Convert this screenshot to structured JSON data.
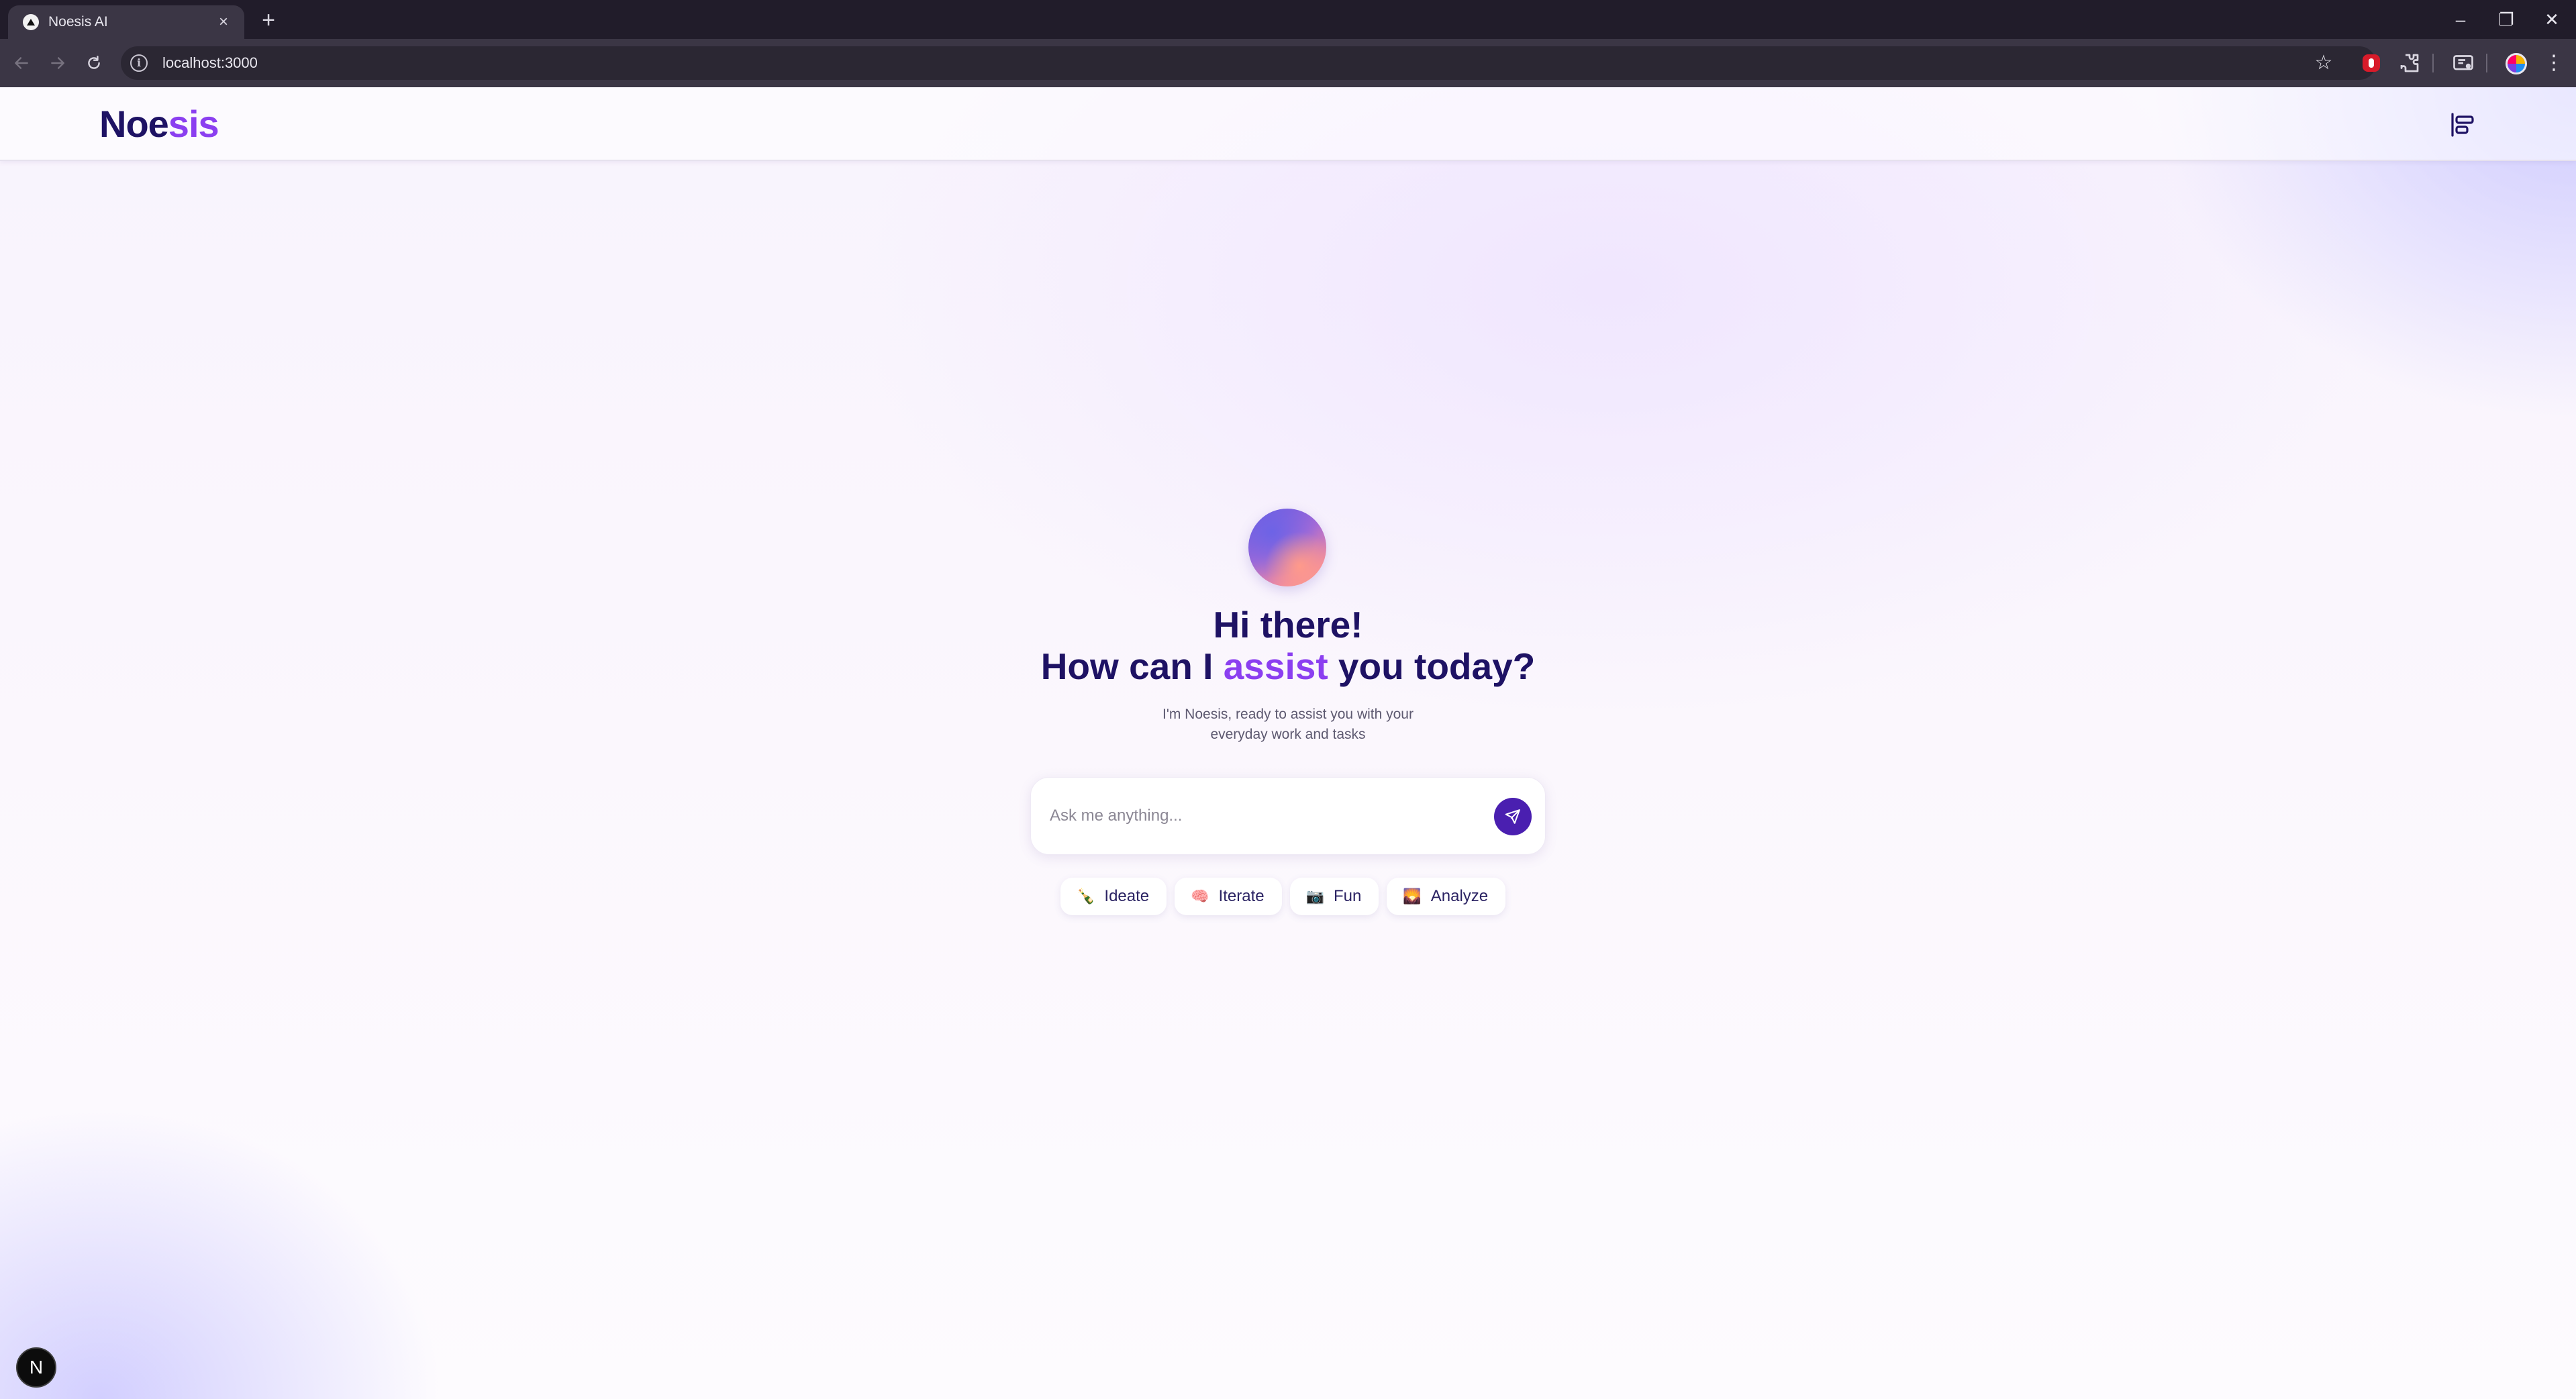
{
  "browser": {
    "tab_title": "Noesis AI",
    "tab_close": "×",
    "new_tab": "+",
    "url": "localhost:3000",
    "window_controls": {
      "minimize": "–",
      "restore": "❐",
      "close": "✕"
    },
    "star": "☆",
    "menu": "⋮"
  },
  "header": {
    "brand_part1": "Noe",
    "brand_part2": "sis"
  },
  "hero": {
    "greeting": "Hi there!",
    "question_prefix": "How can I ",
    "question_accent": "assist",
    "question_suffix": " you today?",
    "subtitle_line1": "I'm Noesis, ready to assist you with your",
    "subtitle_line2": "everyday work and tasks"
  },
  "chat": {
    "placeholder": "Ask me anything..."
  },
  "chips": [
    {
      "emoji": "🍾",
      "label": "Ideate"
    },
    {
      "emoji": "🧠",
      "label": "Iterate"
    },
    {
      "emoji": "📷",
      "label": "Fun"
    },
    {
      "emoji": "🌄",
      "label": "Analyze"
    }
  ],
  "dev_badge": "N",
  "colors": {
    "brand_dark": "#1e1264",
    "brand_accent": "#8b3ff0",
    "send_button": "#4a1fb0"
  },
  "icons": {
    "tab_favicon": "triangle-icon",
    "sidebar_toggle": "align-left-icon",
    "send": "send-icon"
  }
}
